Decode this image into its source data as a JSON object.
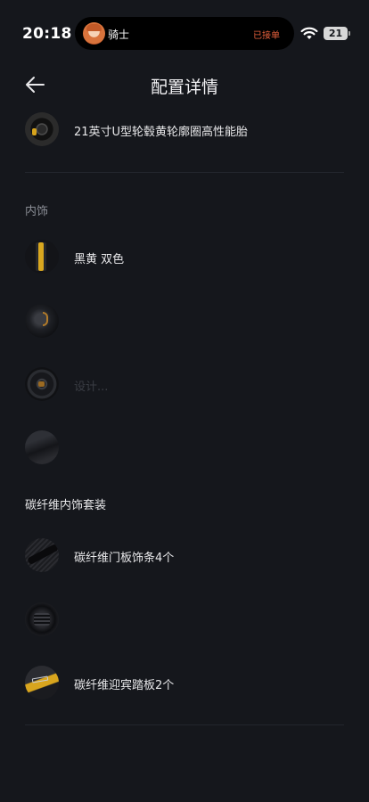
{
  "status_bar": {
    "time": "20:18",
    "island_user": "骑士",
    "island_status": "已接单",
    "battery": "21",
    "island_status_color": "#e5603c"
  },
  "header": {
    "title": "配置详情"
  },
  "top_item": {
    "label": "21英寸U型轮毂黄轮廓圈高性能胎",
    "icon": "wheel-icon"
  },
  "sections": {
    "interior": {
      "title": "内饰",
      "items": [
        {
          "label": "黑黄 双色",
          "icon": "seat-icon"
        },
        {
          "label": "",
          "icon": "headrest-icon"
        },
        {
          "label": "设计...",
          "icon": "steering-wheel-icon"
        },
        {
          "label": "",
          "icon": "gear-shifter-icon"
        }
      ]
    },
    "carbon": {
      "title": "碳纤维内饰套装",
      "items": [
        {
          "label": "碳纤维门板饰条4个",
          "icon": "door-trim-icon"
        },
        {
          "label": "",
          "icon": "air-vent-icon"
        },
        {
          "label": "碳纤维迎宾踏板2个",
          "icon": "door-sill-icon"
        }
      ]
    }
  },
  "colors": {
    "background": "#15171c",
    "accent_yellow": "#d9a71f"
  }
}
